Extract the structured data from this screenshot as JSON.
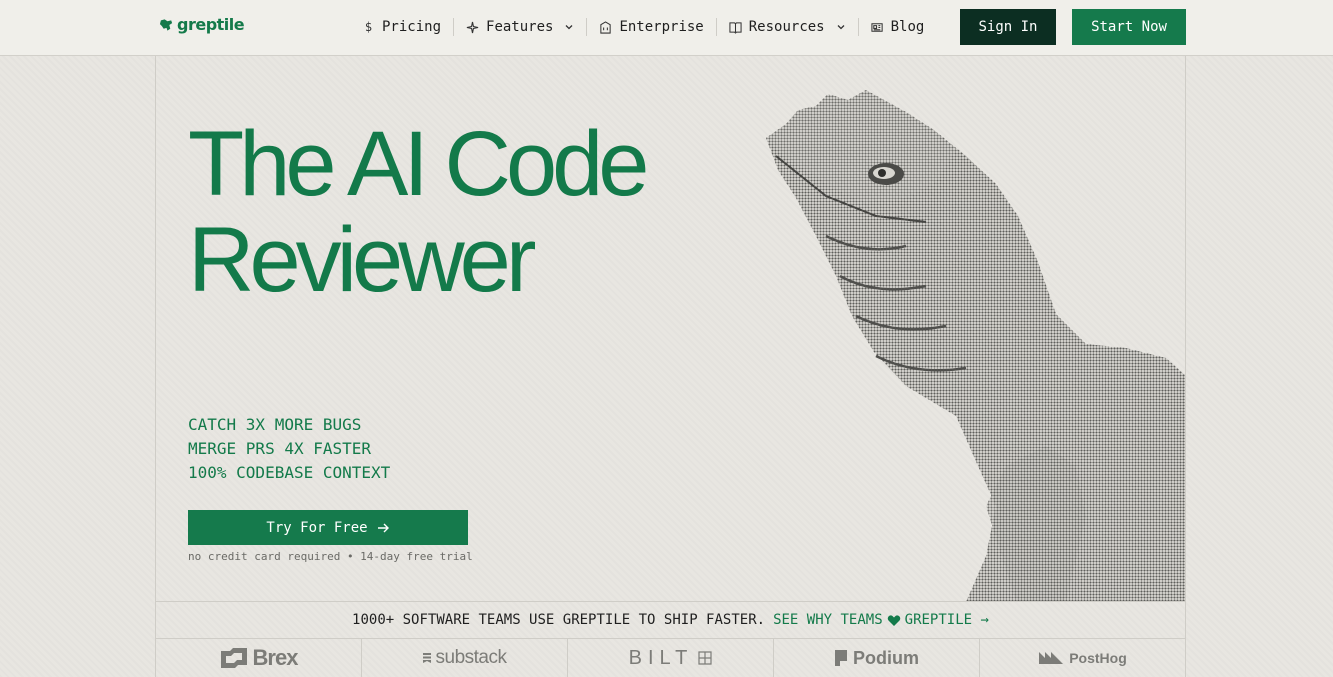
{
  "brand": {
    "name": "greptile",
    "color": "#147a4a"
  },
  "nav": {
    "items": [
      {
        "label": "Pricing",
        "icon": "dollar-icon",
        "dropdown": false
      },
      {
        "label": "Features",
        "icon": "sparkle-icon",
        "dropdown": true
      },
      {
        "label": "Enterprise",
        "icon": "building-icon",
        "dropdown": false
      },
      {
        "label": "Resources",
        "icon": "book-icon",
        "dropdown": true
      },
      {
        "label": "Blog",
        "icon": "newspaper-icon",
        "dropdown": false
      }
    ],
    "sign_in": "Sign In",
    "start_now": "Start Now"
  },
  "hero": {
    "title_line1": "The AI Code",
    "title_line2": "Reviewer",
    "bullets": [
      "CATCH 3X MORE BUGS",
      "MERGE PRS 4X FASTER",
      "100% CODEBASE CONTEXT"
    ],
    "cta": "Try For Free",
    "note": "no credit card required • 14-day free trial"
  },
  "social_proof": {
    "text": "1000+ SOFTWARE TEAMS USE GREPTILE TO SHIP FASTER.",
    "link_prefix": "SEE WHY TEAMS",
    "link_suffix": "GREPTILE →"
  },
  "customer_logos": [
    "Brex",
    "substack",
    "BILT",
    "Podium",
    "PostHog"
  ],
  "colors": {
    "accent": "#157a4c",
    "dark_button": "#0c2e22",
    "background": "#e8e6e1"
  }
}
